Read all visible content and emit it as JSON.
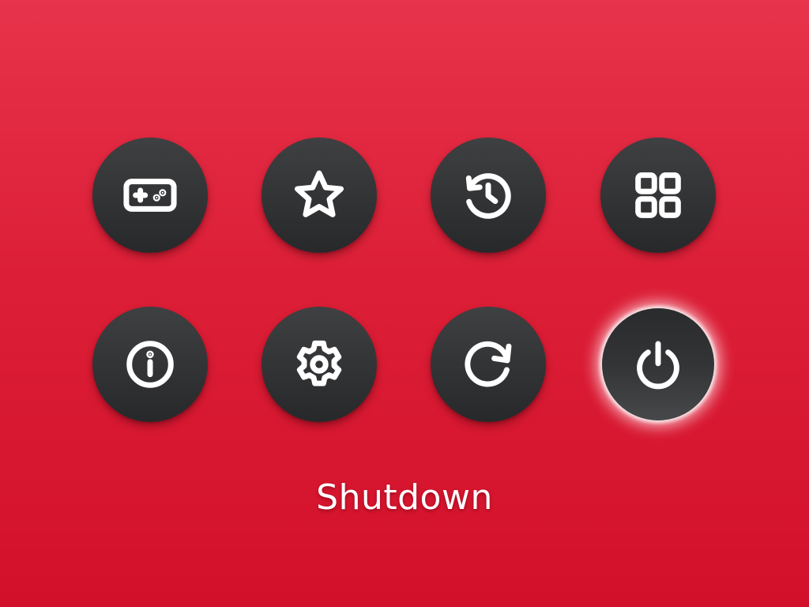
{
  "menu": {
    "items": [
      {
        "id": "games",
        "icon": "gamepad-icon",
        "selected": false
      },
      {
        "id": "favorites",
        "icon": "star-icon",
        "selected": false
      },
      {
        "id": "history",
        "icon": "history-icon",
        "selected": false
      },
      {
        "id": "apps",
        "icon": "grid-icon",
        "selected": false
      },
      {
        "id": "info",
        "icon": "info-icon",
        "selected": false
      },
      {
        "id": "settings",
        "icon": "gear-icon",
        "selected": false
      },
      {
        "id": "restart",
        "icon": "restart-icon",
        "selected": false
      },
      {
        "id": "shutdown",
        "icon": "power-icon",
        "selected": true
      }
    ],
    "selected_label": "Shutdown"
  },
  "colors": {
    "background_top": "#e7334b",
    "background_bottom": "#d3102a",
    "button": "#323335",
    "icon": "#ffffff",
    "selection_glow": "#f4d9dc"
  }
}
